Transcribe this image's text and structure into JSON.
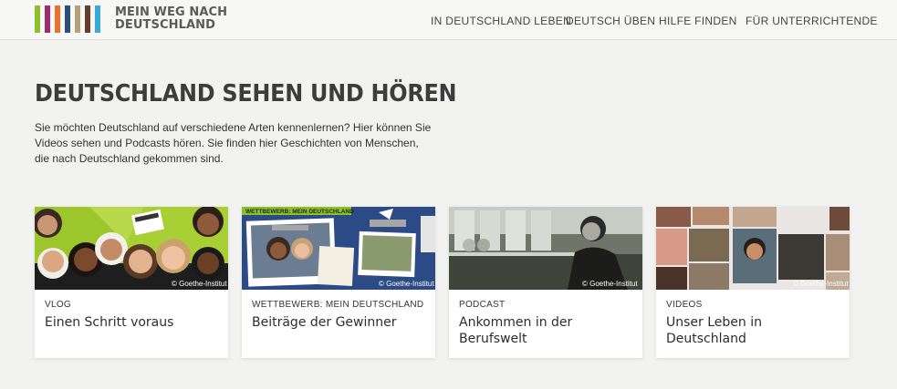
{
  "header": {
    "logo_line1": "MEIN WEG NACH",
    "logo_line2": "DEUTSCHLAND",
    "logo_bars": [
      "#8dbf2a",
      "#9b2d6e",
      "#e8742a",
      "#2a4f7e",
      "#b5a07a",
      "#6a3a2a",
      "#3aa8d8"
    ],
    "nav": [
      {
        "label": "IN DEUTSCHLAND LEBEN"
      },
      {
        "label": "DEUTSCH ÜBEN"
      },
      {
        "label": "HILFE FINDEN"
      },
      {
        "label": "FÜR UNTERRICHTENDE"
      }
    ]
  },
  "main": {
    "title": "DEUTSCHLAND SEHEN UND HÖREN",
    "intro": "Sie möchten Deutschland auf verschiedene Arten kennenlernen? Hier können Sie Videos sehen und Podcasts hören. Sie finden hier Geschichten von Menschen, die nach Deutschland gekommen sind."
  },
  "cards": [
    {
      "category": "VLOG",
      "title": "Einen Schritt voraus",
      "copyright": "© Goethe-Institut"
    },
    {
      "category": "WETTBEWERB: MEIN DEUTSCHLAND",
      "title": "Beiträge der Gewinner",
      "image_banner": "WETTBEWERB: MEIN DEUTSCHLAND",
      "copyright": "© Goethe-Institut"
    },
    {
      "category": "PODCAST",
      "title": "Ankommen in der Berufswelt",
      "copyright": "© Goethe-Institut"
    },
    {
      "category": "VIDEOS",
      "title": "Unser Leben in Deutschland",
      "copyright": "© Goethe-Institut"
    }
  ]
}
